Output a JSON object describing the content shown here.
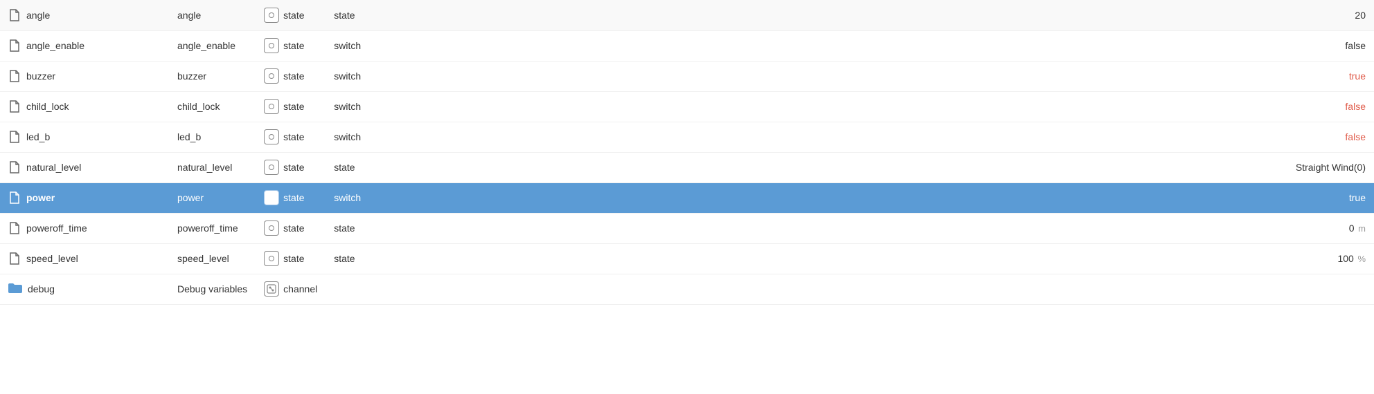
{
  "colors": {
    "selected_bg": "#5b9bd5",
    "value_red": "#e05c4b",
    "text_normal": "#333333",
    "text_white": "#ffffff"
  },
  "rows": [
    {
      "id": "angle",
      "name": "angle",
      "attribute": "angle",
      "type": "state",
      "subtype": "state",
      "value": "20",
      "value_unit": "",
      "value_color": "normal",
      "icon": "file",
      "selected": false
    },
    {
      "id": "angle_enable",
      "name": "angle_enable",
      "attribute": "angle_enable",
      "type": "state",
      "subtype": "switch",
      "value": "false",
      "value_unit": "",
      "value_color": "normal",
      "icon": "file",
      "selected": false
    },
    {
      "id": "buzzer",
      "name": "buzzer",
      "attribute": "buzzer",
      "type": "state",
      "subtype": "switch",
      "value": "true",
      "value_unit": "",
      "value_color": "red",
      "icon": "file",
      "selected": false
    },
    {
      "id": "child_lock",
      "name": "child_lock",
      "attribute": "child_lock",
      "type": "state",
      "subtype": "switch",
      "value": "false",
      "value_unit": "",
      "value_color": "red",
      "icon": "file",
      "selected": false
    },
    {
      "id": "led_b",
      "name": "led_b",
      "attribute": "led_b",
      "type": "state",
      "subtype": "switch",
      "value": "false",
      "value_unit": "",
      "value_color": "red",
      "icon": "file",
      "selected": false
    },
    {
      "id": "natural_level",
      "name": "natural_level",
      "attribute": "natural_level",
      "type": "state",
      "subtype": "state",
      "value": "Straight Wind(0)",
      "value_unit": "",
      "value_color": "normal",
      "icon": "file",
      "selected": false
    },
    {
      "id": "power",
      "name": "power",
      "attribute": "power",
      "type": "state",
      "subtype": "switch",
      "value": "true",
      "value_unit": "",
      "value_color": "white",
      "icon": "file",
      "selected": true
    },
    {
      "id": "poweroff_time",
      "name": "poweroff_time",
      "attribute": "poweroff_time",
      "type": "state",
      "subtype": "state",
      "value": "0",
      "value_unit": "m",
      "value_color": "normal",
      "icon": "file",
      "selected": false
    },
    {
      "id": "speed_level",
      "name": "speed_level",
      "attribute": "speed_level",
      "type": "state",
      "subtype": "state",
      "value": "100",
      "value_unit": "%",
      "value_color": "normal",
      "icon": "file",
      "selected": false
    },
    {
      "id": "debug",
      "name": "debug",
      "attribute": "Debug variables",
      "type": "channel",
      "subtype": "",
      "value": "",
      "value_unit": "",
      "value_color": "normal",
      "icon": "folder",
      "selected": false
    }
  ]
}
